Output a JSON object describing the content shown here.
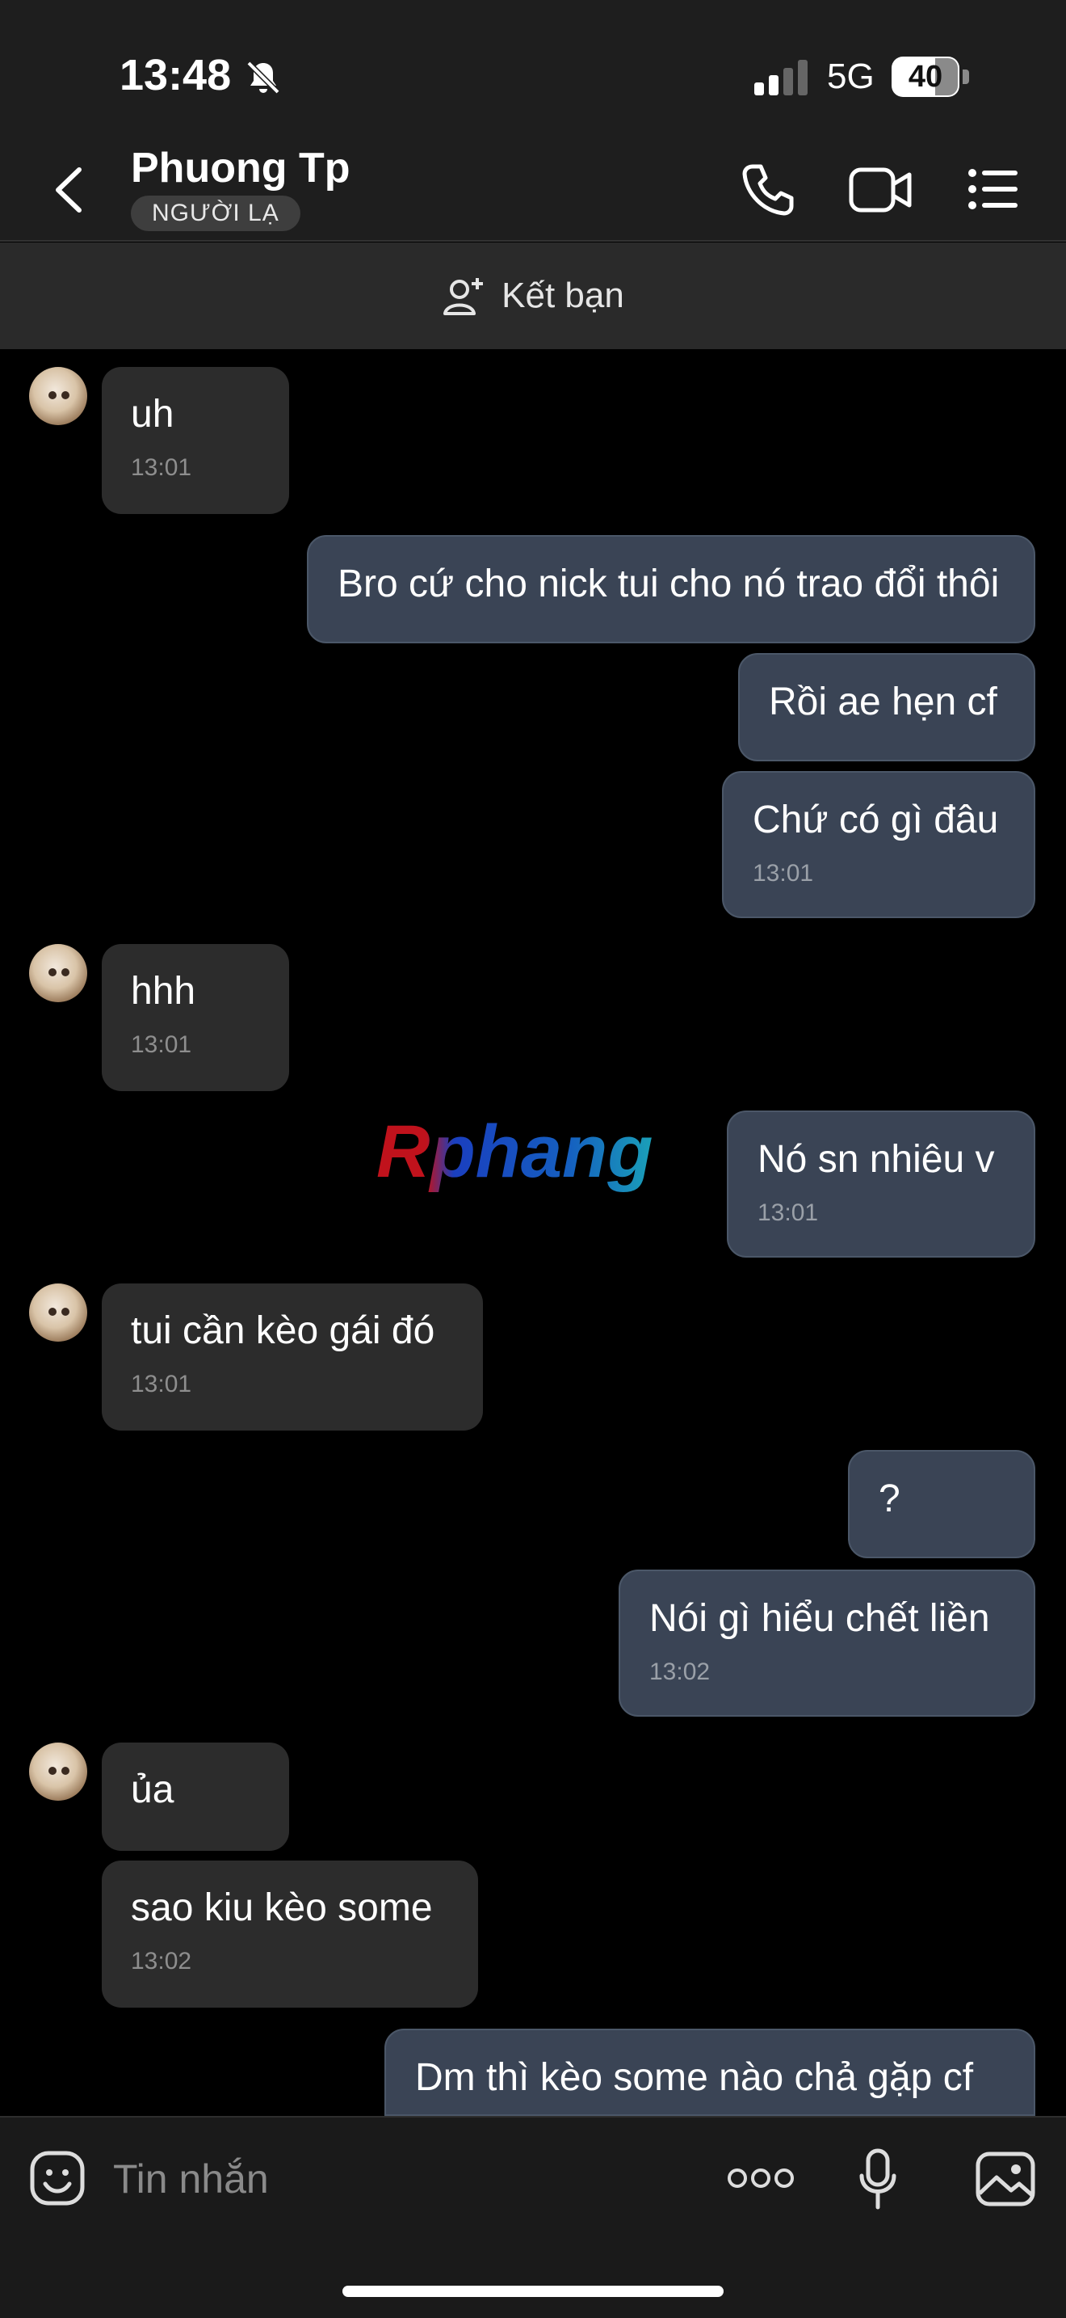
{
  "status_bar": {
    "time": "13:48",
    "network": "5G",
    "battery": "40",
    "battery_level": 0.4
  },
  "header": {
    "contact_name": "Phuong Tp",
    "badge": "NGƯỜI LẠ"
  },
  "friend_bar": {
    "label": "Kết bạn"
  },
  "watermark": "Rphang",
  "messages": [
    {
      "dir": "in",
      "text": "uh",
      "time": "13:01"
    },
    {
      "dir": "out",
      "text": "Bro cứ cho nick tui cho nó trao đổi thôi",
      "time": ""
    },
    {
      "dir": "out",
      "text": "Rồi ae hẹn cf",
      "time": ""
    },
    {
      "dir": "out",
      "text": "Chứ có gì đâu",
      "time": "13:01"
    },
    {
      "dir": "in",
      "text": "hhh",
      "time": "13:01"
    },
    {
      "dir": "out",
      "text": "Nó sn nhiêu v",
      "time": "13:01"
    },
    {
      "dir": "in",
      "text": "tui cần kèo gái đó",
      "time": "13:01"
    },
    {
      "dir": "out",
      "text": "?",
      "time": ""
    },
    {
      "dir": "out",
      "text": "Nói gì hiểu chết liền",
      "time": "13:02"
    },
    {
      "dir": "in",
      "text": "ủa",
      "time": ""
    },
    {
      "dir": "in",
      "text": "sao kiu kèo some",
      "time": "13:02"
    },
    {
      "dir": "out",
      "text": "Dm thì kèo some nào chả gặp cf",
      "time": ""
    }
  ],
  "composer": {
    "placeholder": "Tin nhắn"
  },
  "colors": {
    "incoming_bubble": "#2c2c2c",
    "outgoing_bubble": "#3a4455",
    "header": "#1e1e1e",
    "background": "#000000"
  }
}
